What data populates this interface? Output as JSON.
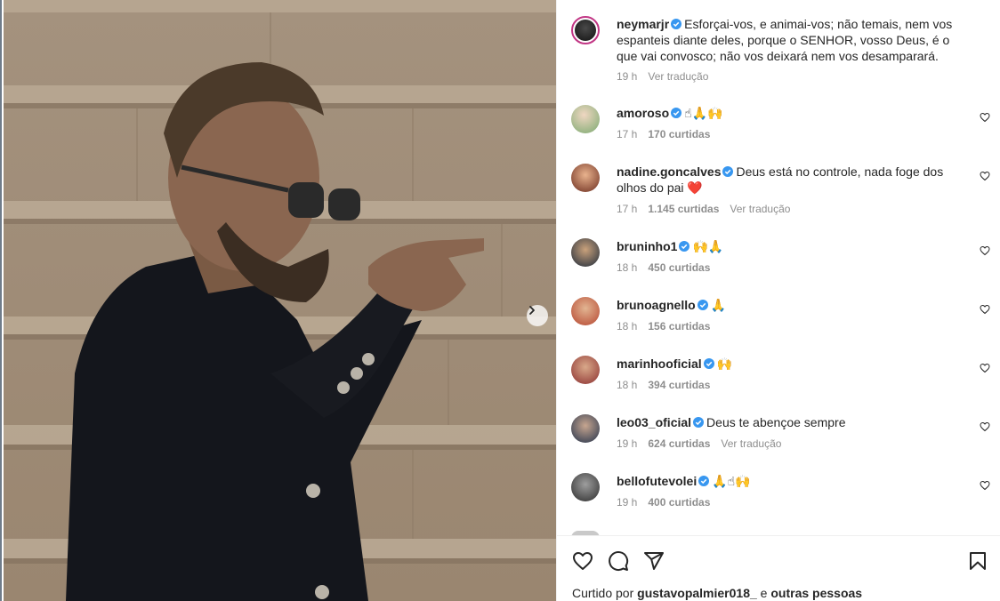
{
  "post": {
    "caption": {
      "username": "neymarjr",
      "text": "Esforçai-vos, e animai-vos; não temais, nem vos espanteis diante deles, porque o SENHOR, vosso Deus, é o que vai convosco; não vos deixará nem vos desamparará.",
      "time": "19 h",
      "translate": "Ver tradução"
    },
    "comments": [
      {
        "username": "amoroso",
        "text": "☝🙏🙌",
        "time": "17 h",
        "likes": "170 curtidas",
        "translate": ""
      },
      {
        "username": "nadine.goncalves",
        "text": "Deus está no controle, nada foge dos olhos do pai ❤️",
        "time": "17 h",
        "likes": "1.145 curtidas",
        "translate": "Ver tradução"
      },
      {
        "username": "bruninho1",
        "text": "🙌🙏",
        "time": "18 h",
        "likes": "450 curtidas",
        "translate": ""
      },
      {
        "username": "brunoagnello",
        "text": "🙏",
        "time": "18 h",
        "likes": "156 curtidas",
        "translate": ""
      },
      {
        "username": "marinhooficial",
        "text": "🙌",
        "time": "18 h",
        "likes": "394 curtidas",
        "translate": ""
      },
      {
        "username": "leo03_oficial",
        "text": "Deus te abençoe sempre",
        "time": "19 h",
        "likes": "624 curtidas",
        "translate": "Ver tradução"
      },
      {
        "username": "bellofutevolei",
        "text": "🙏☝🙌",
        "time": "19 h",
        "likes": "400 curtidas",
        "translate": ""
      }
    ],
    "liked_by": {
      "prefix": "Curtido por",
      "user": "gustavopalmier018_",
      "middle": "e",
      "others": "outras pessoas"
    }
  },
  "icons": {
    "like": "heart-icon",
    "comment": "comment-icon",
    "share": "share-icon",
    "save": "bookmark-icon",
    "next": "chevron-right-icon",
    "verified": "verified-badge-icon"
  },
  "colors": {
    "verified": "#3897f0",
    "meta_text": "#8e8e8e",
    "text": "#262626",
    "heart_emoji": "#e0245e"
  }
}
